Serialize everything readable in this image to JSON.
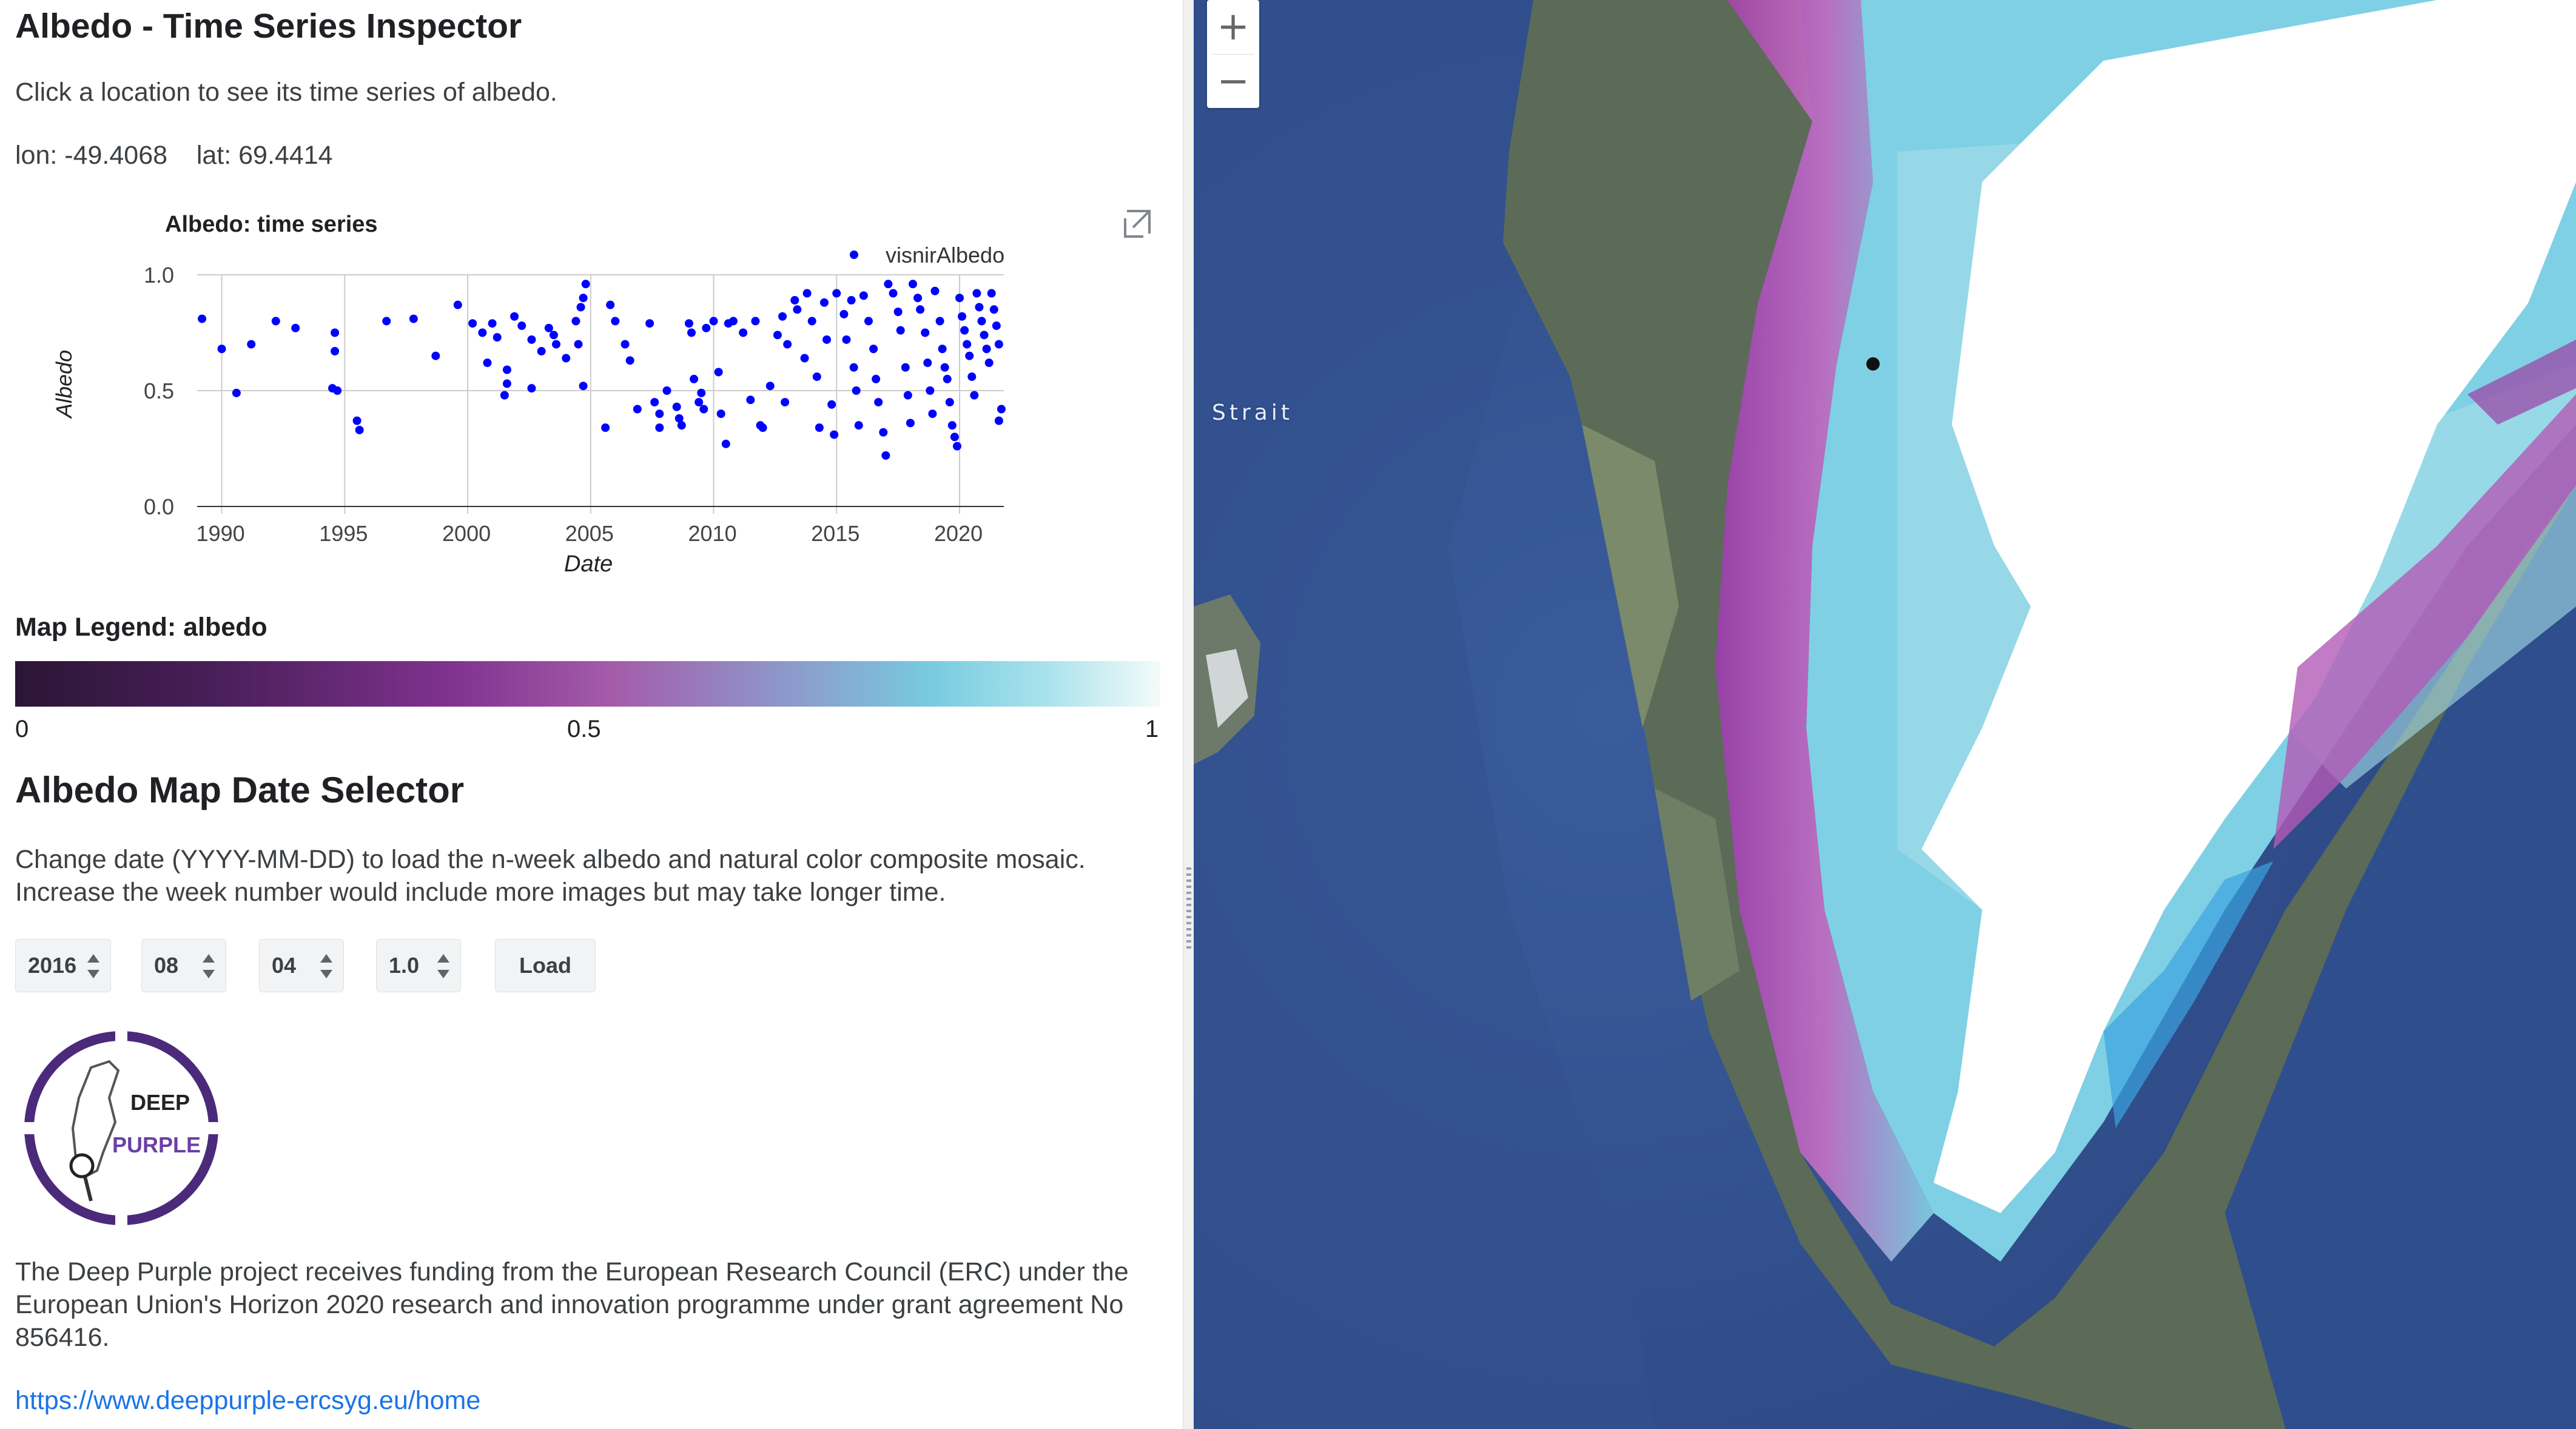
{
  "app": {
    "title": "Albedo - Time Series Inspector",
    "instruction": "Click a location to see its time series of albedo."
  },
  "location": {
    "lon_label": "lon: -49.4068",
    "lat_label": "lat: 69.4414"
  },
  "chart_data": {
    "type": "scatter",
    "title": "Albedo: time series",
    "xlabel": "Date",
    "ylabel": "Albedo",
    "xlim": [
      1989,
      2021.8
    ],
    "ylim": [
      0,
      1
    ],
    "x_ticks": [
      "1990",
      "1995",
      "2000",
      "2005",
      "2010",
      "2015",
      "2020"
    ],
    "y_ticks": [
      "0.0",
      "0.5",
      "1.0"
    ],
    "legend": "top-right",
    "grid": true,
    "series": [
      {
        "name": "visnirAlbedo",
        "color": "#0000ff",
        "points": [
          [
            1989.2,
            0.81
          ],
          [
            1990.0,
            0.68
          ],
          [
            1990.6,
            0.49
          ],
          [
            1991.2,
            0.7
          ],
          [
            1992.2,
            0.8
          ],
          [
            1993.0,
            0.77
          ],
          [
            1994.6,
            0.75
          ],
          [
            1994.6,
            0.67
          ],
          [
            1994.7,
            0.5
          ],
          [
            1994.5,
            0.51
          ],
          [
            1995.5,
            0.37
          ],
          [
            1995.6,
            0.33
          ],
          [
            1996.7,
            0.8
          ],
          [
            1997.8,
            0.81
          ],
          [
            1998.7,
            0.65
          ],
          [
            1999.6,
            0.87
          ],
          [
            2000.2,
            0.79
          ],
          [
            2000.6,
            0.75
          ],
          [
            2000.8,
            0.62
          ],
          [
            2001.0,
            0.79
          ],
          [
            2001.2,
            0.73
          ],
          [
            2001.6,
            0.53
          ],
          [
            2001.6,
            0.59
          ],
          [
            2001.5,
            0.48
          ],
          [
            2001.9,
            0.82
          ],
          [
            2002.2,
            0.78
          ],
          [
            2002.6,
            0.72
          ],
          [
            2003.0,
            0.67
          ],
          [
            2002.6,
            0.51
          ],
          [
            2003.3,
            0.77
          ],
          [
            2003.6,
            0.7
          ],
          [
            2003.5,
            0.74
          ],
          [
            2004.0,
            0.64
          ],
          [
            2004.4,
            0.8
          ],
          [
            2004.6,
            0.86
          ],
          [
            2004.7,
            0.9
          ],
          [
            2004.8,
            0.96
          ],
          [
            2004.7,
            0.52
          ],
          [
            2004.5,
            0.7
          ],
          [
            2005.6,
            0.34
          ],
          [
            2005.8,
            0.87
          ],
          [
            2006.0,
            0.8
          ],
          [
            2006.4,
            0.7
          ],
          [
            2006.6,
            0.63
          ],
          [
            2006.9,
            0.42
          ],
          [
            2007.4,
            0.79
          ],
          [
            2007.6,
            0.45
          ],
          [
            2007.8,
            0.4
          ],
          [
            2007.8,
            0.34
          ],
          [
            2008.1,
            0.5
          ],
          [
            2008.5,
            0.43
          ],
          [
            2008.6,
            0.38
          ],
          [
            2008.7,
            0.35
          ],
          [
            2009.0,
            0.79
          ],
          [
            2009.1,
            0.75
          ],
          [
            2009.2,
            0.55
          ],
          [
            2009.5,
            0.49
          ],
          [
            2009.4,
            0.45
          ],
          [
            2009.6,
            0.42
          ],
          [
            2009.7,
            0.77
          ],
          [
            2010.0,
            0.8
          ],
          [
            2010.2,
            0.58
          ],
          [
            2010.3,
            0.4
          ],
          [
            2010.5,
            0.27
          ],
          [
            2010.6,
            0.79
          ],
          [
            2010.8,
            0.8
          ],
          [
            2011.2,
            0.75
          ],
          [
            2011.5,
            0.46
          ],
          [
            2011.7,
            0.8
          ],
          [
            2011.9,
            0.35
          ],
          [
            2012.0,
            0.34
          ],
          [
            2012.3,
            0.52
          ],
          [
            2012.6,
            0.74
          ],
          [
            2012.8,
            0.82
          ],
          [
            2012.9,
            0.45
          ],
          [
            2013.0,
            0.7
          ],
          [
            2013.3,
            0.89
          ],
          [
            2013.4,
            0.85
          ],
          [
            2013.7,
            0.64
          ],
          [
            2013.8,
            0.92
          ],
          [
            2014.0,
            0.8
          ],
          [
            2014.2,
            0.56
          ],
          [
            2014.3,
            0.34
          ],
          [
            2014.5,
            0.88
          ],
          [
            2014.6,
            0.72
          ],
          [
            2014.8,
            0.44
          ],
          [
            2014.9,
            0.31
          ],
          [
            2015.0,
            0.92
          ],
          [
            2015.3,
            0.83
          ],
          [
            2015.4,
            0.72
          ],
          [
            2015.6,
            0.89
          ],
          [
            2015.7,
            0.6
          ],
          [
            2015.8,
            0.5
          ],
          [
            2015.9,
            0.35
          ],
          [
            2016.1,
            0.91
          ],
          [
            2016.3,
            0.8
          ],
          [
            2016.5,
            0.68
          ],
          [
            2016.6,
            0.55
          ],
          [
            2016.7,
            0.45
          ],
          [
            2016.9,
            0.32
          ],
          [
            2017.0,
            0.22
          ],
          [
            2017.1,
            0.96
          ],
          [
            2017.3,
            0.92
          ],
          [
            2017.5,
            0.84
          ],
          [
            2017.6,
            0.76
          ],
          [
            2017.8,
            0.6
          ],
          [
            2017.9,
            0.48
          ],
          [
            2018.0,
            0.36
          ],
          [
            2018.1,
            0.96
          ],
          [
            2018.3,
            0.9
          ],
          [
            2018.4,
            0.85
          ],
          [
            2018.6,
            0.75
          ],
          [
            2018.7,
            0.62
          ],
          [
            2018.8,
            0.5
          ],
          [
            2018.9,
            0.4
          ],
          [
            2019.0,
            0.93
          ],
          [
            2019.2,
            0.8
          ],
          [
            2019.3,
            0.68
          ],
          [
            2019.4,
            0.6
          ],
          [
            2019.5,
            0.55
          ],
          [
            2019.6,
            0.45
          ],
          [
            2019.7,
            0.35
          ],
          [
            2019.8,
            0.3
          ],
          [
            2019.9,
            0.26
          ],
          [
            2020.0,
            0.9
          ],
          [
            2020.1,
            0.82
          ],
          [
            2020.2,
            0.76
          ],
          [
            2020.3,
            0.7
          ],
          [
            2020.4,
            0.65
          ],
          [
            2020.5,
            0.56
          ],
          [
            2020.6,
            0.48
          ],
          [
            2020.7,
            0.92
          ],
          [
            2020.8,
            0.86
          ],
          [
            2020.9,
            0.8
          ],
          [
            2021.0,
            0.74
          ],
          [
            2021.1,
            0.68
          ],
          [
            2021.2,
            0.62
          ],
          [
            2021.3,
            0.92
          ],
          [
            2021.4,
            0.85
          ],
          [
            2021.5,
            0.78
          ],
          [
            2021.6,
            0.7
          ],
          [
            2021.7,
            0.42
          ],
          [
            2021.6,
            0.37
          ]
        ]
      }
    ]
  },
  "legend": {
    "title": "Map Legend: albedo",
    "min": "0",
    "mid": "0.5",
    "max": "1",
    "colors": [
      "#2b1535",
      "#80328f",
      "#78cbe0",
      "#f4fbf9"
    ]
  },
  "selector": {
    "title": "Albedo Map Date Selector",
    "desc_line1": "Change date (YYYY-MM-DD) to load the n-week albedo and natural color composite mosaic.",
    "desc_line2": "Increase the week number would include more images but may take longer time.",
    "year": "2016",
    "month": "08",
    "day": "04",
    "weeks": "1.0",
    "load_label": "Load"
  },
  "logo": {
    "text_top": "DEEP",
    "text_bottom": "PURPLE"
  },
  "funding": {
    "line1": "The Deep Purple project receives funding from the European Research Council (ERC) under the",
    "line2": "European Union's Horizon 2020 research and innovation programme under grant agreement No",
    "line3": "856416.",
    "link": "https://www.deeppurple-ercsyg.eu/home"
  },
  "map": {
    "zoom_in": "+",
    "zoom_out": "−",
    "label": "Strait"
  }
}
